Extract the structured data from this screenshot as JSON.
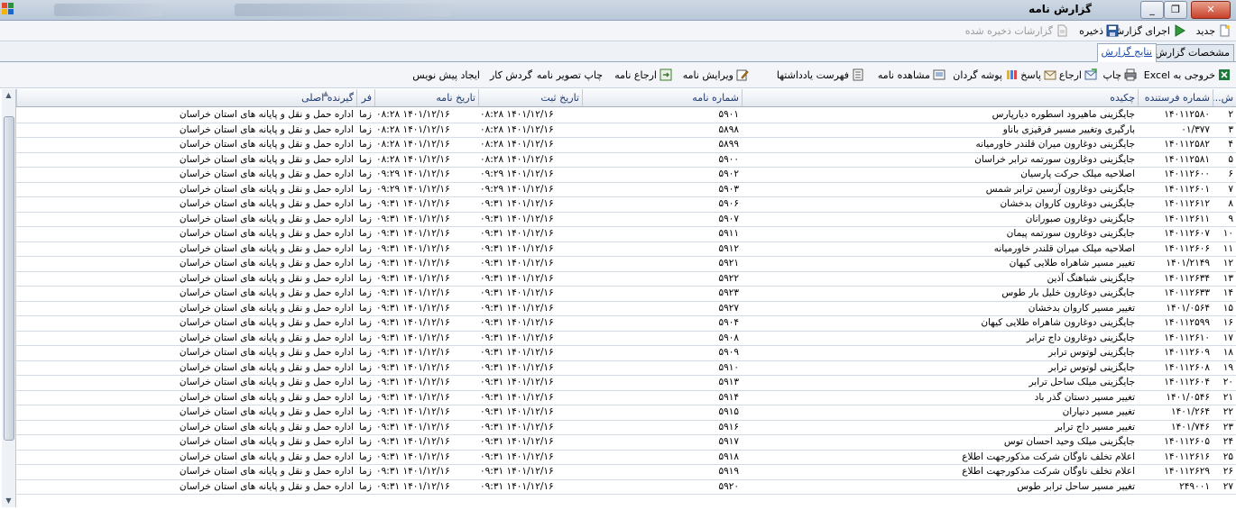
{
  "window": {
    "title": "گزارش نامه",
    "buttons": [
      "_",
      "❐",
      "✕"
    ]
  },
  "toolbar1": {
    "new_label": "جدید",
    "run_label": "اجرای گزارش",
    "save_label": "ذخیره",
    "saved_label": "گزارشات ذخیره شده"
  },
  "tabs": {
    "spec": "مشخصات گزارش",
    "result": "نتایج گزارش"
  },
  "toolbar2": {
    "excel": "خروجی به Excel",
    "print": "چاپ",
    "refer": "ارجاع",
    "reply": "پاسخ",
    "folder": "پوشه گردان",
    "view": "مشاهده نامه",
    "notes": "فهرست یادداشتها",
    "edit": "ویرایش نامه",
    "refer_letter": "ارجاع نامه",
    "print_image": "چاپ تصویر نامه",
    "workflow": "گردش کار",
    "draft": "ایجاد پیش نویس"
  },
  "grid": {
    "columns": [
      "ش...",
      "شماره فرستنده",
      "چکیده",
      "شماره نامه",
      "تاریخ ثبت",
      "تاریخ نامه",
      "فر",
      "گیرنده اصلی"
    ],
    "rows": [
      [
        "۲",
        "۱۴۰۱۱۲۵۸۰",
        "جایگزینی ماهیرود اسطوره دیارپارس",
        "۵۹۰۱",
        "۱۴۰۱/۱۲/۱۶ ۰۸:۲۸",
        "۱۴۰۱/۱۲/۱۶ ۰۸:۲۸",
        "زما",
        "اداره حمل و نقل و پایانه های استان خراسان"
      ],
      [
        "۳",
        "۰۱/۳۷۷",
        "بارگیری وتغییر مسیر فرقیزی باناو",
        "۵۸۹۸",
        "۱۴۰۱/۱۲/۱۶ ۰۸:۲۸",
        "۱۴۰۱/۱۲/۱۶ ۰۸:۲۸",
        "زما",
        "اداره حمل و نقل و پایانه های استان خراسان"
      ],
      [
        "۴",
        "۱۴۰۱۱۲۵۸۲",
        "جایگزینی دوغارون میران قلندر خاورمیانه",
        "۵۸۹۹",
        "۱۴۰۱/۱۲/۱۶ ۰۸:۲۸",
        "۱۴۰۱/۱۲/۱۶ ۰۸:۲۸",
        "زما",
        "اداره حمل و نقل و پایانه های استان خراسان"
      ],
      [
        "۵",
        "۱۴۰۱۱۲۵۸۱",
        "جایگزینی دوغارون سورتمه ترابر خراسان",
        "۵۹۰۰",
        "۱۴۰۱/۱۲/۱۶ ۰۸:۲۸",
        "۱۴۰۱/۱۲/۱۶ ۰۸:۲۸",
        "زما",
        "اداره حمل و نقل و پایانه های استان خراسان"
      ],
      [
        "۶",
        "۱۴۰۱۱۲۶۰۰",
        "اصلاحیه میلک حرکت پارسیان",
        "۵۹۰۲",
        "۱۴۰۱/۱۲/۱۶ ۰۹:۲۹",
        "۱۴۰۱/۱۲/۱۶ ۰۹:۲۹",
        "زما",
        "اداره حمل و نقل و پایانه های استان خراسان"
      ],
      [
        "۷",
        "۱۴۰۱۱۲۶۰۱",
        "جایگزینی دوغارون آرسین ترابر شمس",
        "۵۹۰۳",
        "۱۴۰۱/۱۲/۱۶ ۰۹:۲۹",
        "۱۴۰۱/۱۲/۱۶ ۰۹:۲۹",
        "زما",
        "اداره حمل و نقل و پایانه های استان خراسان"
      ],
      [
        "۸",
        "۱۴۰۱۱۲۶۱۲",
        "جایگزینی دوغارون کاروان بدخشان",
        "۵۹۰۶",
        "۱۴۰۱/۱۲/۱۶ ۰۹:۳۱",
        "۱۴۰۱/۱۲/۱۶ ۰۹:۳۱",
        "زما",
        "اداره حمل و نقل و پایانه های استان خراسان"
      ],
      [
        "۹",
        "۱۴۰۱۱۲۶۱۱",
        "جایگزینی دوغارون صبورانان",
        "۵۹۰۷",
        "۱۴۰۱/۱۲/۱۶ ۰۹:۳۱",
        "۱۴۰۱/۱۲/۱۶ ۰۹:۳۱",
        "زما",
        "اداره حمل و نقل و پایانه های استان خراسان"
      ],
      [
        "۱۰",
        "۱۴۰۱۱۲۶۰۷",
        "جایگزینی دوغارون سورتمه پیمان",
        "۵۹۱۱",
        "۱۴۰۱/۱۲/۱۶ ۰۹:۳۱",
        "۱۴۰۱/۱۲/۱۶ ۰۹:۳۱",
        "زما",
        "اداره حمل و نقل و پایانه های استان خراسان"
      ],
      [
        "۱۱",
        "۱۴۰۱۱۲۶۰۶",
        "اصلاحیه میلک میران قلندر خاورمیانه",
        "۵۹۱۲",
        "۱۴۰۱/۱۲/۱۶ ۰۹:۳۱",
        "۱۴۰۱/۱۲/۱۶ ۰۹:۳۱",
        "زما",
        "اداره حمل و نقل و پایانه های استان خراسان"
      ],
      [
        "۱۲",
        "۱۴۰۱/۲۱۴۹",
        "تغییر مسیر شاهراه طلایی کیهان",
        "۵۹۲۱",
        "۱۴۰۱/۱۲/۱۶ ۰۹:۳۱",
        "۱۴۰۱/۱۲/۱۶ ۰۹:۳۱",
        "زما",
        "اداره حمل و نقل و پایانه های استان خراسان"
      ],
      [
        "۱۳",
        "۱۴۰۱۱۲۶۳۴",
        "جایگزینی شباهنگ آذین",
        "۵۹۲۲",
        "۱۴۰۱/۱۲/۱۶ ۰۹:۳۱",
        "۱۴۰۱/۱۲/۱۶ ۰۹:۳۱",
        "زما",
        "اداره حمل و نقل و پایانه های استان خراسان"
      ],
      [
        "۱۴",
        "۱۴۰۱۱۲۶۳۳",
        "جایگزینی دوغارون خلیل بار طوس",
        "۵۹۲۳",
        "۱۴۰۱/۱۲/۱۶ ۰۹:۳۱",
        "۱۴۰۱/۱۲/۱۶ ۰۹:۳۱",
        "زما",
        "اداره حمل و نقل و پایانه های استان خراسان"
      ],
      [
        "۱۵",
        "۱۴۰۱/۰۵۶۴",
        "تغییر مسیر کاروان بدخشان",
        "۵۹۲۷",
        "۱۴۰۱/۱۲/۱۶ ۰۹:۳۱",
        "۱۴۰۱/۱۲/۱۶ ۰۹:۳۱",
        "زما",
        "اداره حمل و نقل و پایانه های استان خراسان"
      ],
      [
        "۱۶",
        "۱۴۰۱۱۲۵۹۹",
        "جایگزینی دوغارون شاهراه طلایی کیهان",
        "۵۹۰۴",
        "۱۴۰۱/۱۲/۱۶ ۰۹:۳۱",
        "۱۴۰۱/۱۲/۱۶ ۰۹:۳۱",
        "زما",
        "اداره حمل و نقل و پایانه های استان خراسان"
      ],
      [
        "۱۷",
        "۱۴۰۱۱۲۶۱۰",
        "جایگزینی دوغارون داج ترابر",
        "۵۹۰۸",
        "۱۴۰۱/۱۲/۱۶ ۰۹:۳۱",
        "۱۴۰۱/۱۲/۱۶ ۰۹:۳۱",
        "زما",
        "اداره حمل و نقل و پایانه های استان خراسان"
      ],
      [
        "۱۸",
        "۱۴۰۱۱۲۶۰۹",
        "جایگزینی لوتوس ترابر",
        "۵۹۰۹",
        "۱۴۰۱/۱۲/۱۶ ۰۹:۳۱",
        "۱۴۰۱/۱۲/۱۶ ۰۹:۳۱",
        "زما",
        "اداره حمل و نقل و پایانه های استان خراسان"
      ],
      [
        "۱۹",
        "۱۴۰۱۱۲۶۰۸",
        "جایگزینی لوتوس ترابر",
        "۵۹۱۰",
        "۱۴۰۱/۱۲/۱۶ ۰۹:۳۱",
        "۱۴۰۱/۱۲/۱۶ ۰۹:۳۱",
        "زما",
        "اداره حمل و نقل و پایانه های استان خراسان"
      ],
      [
        "۲۰",
        "۱۴۰۱۱۲۶۰۴",
        "جایگزینی میلک ساحل ترابر",
        "۵۹۱۳",
        "۱۴۰۱/۱۲/۱۶ ۰۹:۳۱",
        "۱۴۰۱/۱۲/۱۶ ۰۹:۳۱",
        "زما",
        "اداره حمل و نقل و پایانه های استان خراسان"
      ],
      [
        "۲۱",
        "۱۴۰۱/۰۵۴۶",
        "تغییر مسیر دستان گذر باد",
        "۵۹۱۴",
        "۱۴۰۱/۱۲/۱۶ ۰۹:۳۱",
        "۱۴۰۱/۱۲/۱۶ ۰۹:۳۱",
        "زما",
        "اداره حمل و نقل و پایانه های استان خراسان"
      ],
      [
        "۲۲",
        "۱۴۰۱/۲۶۴",
        "تغییر مسیر دنیاران",
        "۵۹۱۵",
        "۱۴۰۱/۱۲/۱۶ ۰۹:۳۱",
        "۱۴۰۱/۱۲/۱۶ ۰۹:۳۱",
        "زما",
        "اداره حمل و نقل و پایانه های استان خراسان"
      ],
      [
        "۲۳",
        "۱۴۰۱/۷۴۶",
        "تغییر مسیر داج ترابر",
        "۵۹۱۶",
        "۱۴۰۱/۱۲/۱۶ ۰۹:۳۱",
        "۱۴۰۱/۱۲/۱۶ ۰۹:۳۱",
        "زما",
        "اداره حمل و نقل و پایانه های استان خراسان"
      ],
      [
        "۲۴",
        "۱۴۰۱۱۲۶۰۵",
        "جایگزینی میلک وحید احسان توس",
        "۵۹۱۷",
        "۱۴۰۱/۱۲/۱۶ ۰۹:۳۱",
        "۱۴۰۱/۱۲/۱۶ ۰۹:۳۱",
        "زما",
        "اداره حمل و نقل و پایانه های استان خراسان"
      ],
      [
        "۲۵",
        "۱۴۰۱۱۲۶۱۶",
        "اعلام تخلف ناوگان شرکت مذکورجهت اطلاع",
        "۵۹۱۸",
        "۱۴۰۱/۱۲/۱۶ ۰۹:۳۱",
        "۱۴۰۱/۱۲/۱۶ ۰۹:۳۱",
        "زما",
        "اداره حمل و نقل و پایانه های استان خراسان"
      ],
      [
        "۲۶",
        "۱۴۰۱۱۲۶۲۹",
        "اعلام تخلف ناوگان شرکت مذکورجهت اطلاع",
        "۵۹۱۹",
        "۱۴۰۱/۱۲/۱۶ ۰۹:۳۱",
        "۱۴۰۱/۱۲/۱۶ ۰۹:۳۱",
        "زما",
        "اداره حمل و نقل و پایانه های استان خراسان"
      ],
      [
        "۲۷",
        "۲۴۹۰۰۱",
        "تغییر مسیر ساحل ترابر طوس",
        "۵۹۲۰",
        "۱۴۰۱/۱۲/۱۶ ۰۹:۳۱",
        "۱۴۰۱/۱۲/۱۶ ۰۹:۳۱",
        "زما",
        "اداره حمل و نقل و پایانه های استان خراسان"
      ]
    ]
  },
  "colors": {
    "header_text": "#1e3a70",
    "link": "#1c49a8",
    "excel": "#1d7a3a",
    "close_button": "#c7412b"
  }
}
